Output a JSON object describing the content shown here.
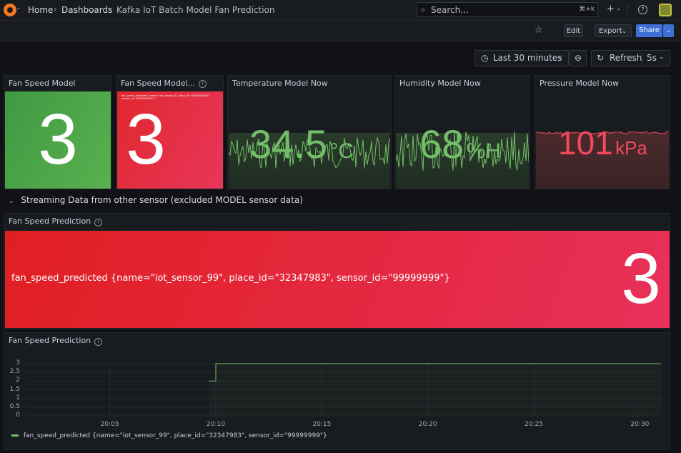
{
  "nav": {
    "home": "Home",
    "dashboards": "Dashboards",
    "dashboard_title": "Kafka IoT Batch Model Fan Prediction",
    "search_placeholder": "Search...",
    "search_shortcut": "⌘+k",
    "plus": "+",
    "help": "?"
  },
  "toolbar": {
    "edit": "Edit",
    "export": "Export",
    "share": "Share"
  },
  "time": {
    "range": "Last 30 minutes",
    "refresh": "Refresh",
    "interval": "5s"
  },
  "panels": {
    "fan_speed_model": {
      "title": "Fan Speed Model",
      "value": "3",
      "color": "#56a64b"
    },
    "fan_speed_model2": {
      "title": "Fan Speed Model...",
      "value": "3",
      "mini_label": "fan_speed_predicted {name=\"iot_sensor_0\", place_id=\"5000000000\", sensor_id=\"5000000000\"}",
      "color": "#e02f44"
    },
    "temperature": {
      "title": "Temperature Model Now",
      "value": "34.5",
      "unit": "°C",
      "value_color": "#73bf69"
    },
    "humidity": {
      "title": "Humidity Model Now",
      "value": "68",
      "unit": "%H",
      "value_color": "#73bf69"
    },
    "pressure": {
      "title": "Pressure Model Now",
      "value": "101",
      "unit": "kPa",
      "value_color": "#f2495c"
    }
  },
  "section": {
    "title": "Streaming Data from other sensor (excluded MODEL sensor data)"
  },
  "prediction_stat": {
    "title": "Fan Speed Prediction",
    "label": "fan_speed_predicted {name=\"iot_sensor_99\", place_id=\"32347983\", sensor_id=\"99999999\"}",
    "value": "3"
  },
  "prediction_graph": {
    "title": "Fan Speed Prediction",
    "legend": "fan_speed_predicted {name=\"iot_sensor_99\", place_id=\"32347983\", sensor_id=\"99999999\"}"
  },
  "chart_data": {
    "type": "line",
    "ylim": [
      0,
      3
    ],
    "y_ticks": [
      "3",
      "2.5",
      "2",
      "1.5",
      "1",
      "0.5",
      "0"
    ],
    "x_ticks": [
      "20:05",
      "20:10",
      "20:15",
      "20:20",
      "20:25",
      "20:30"
    ],
    "xlim": [
      "20:01",
      "20:31"
    ],
    "series": [
      {
        "name": "fan_speed_predicted {name=\"iot_sensor_99\", place_id=\"32347983\", sensor_id=\"99999999\"}",
        "color": "#73bf69",
        "x": [
          "20:09:40",
          "20:10:00",
          "20:10:00",
          "20:31"
        ],
        "y": [
          2,
          2,
          3,
          3
        ]
      }
    ]
  }
}
